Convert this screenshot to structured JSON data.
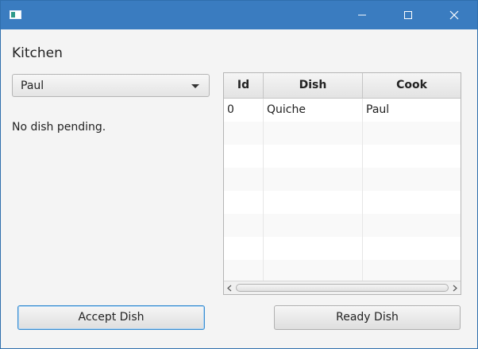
{
  "window": {
    "title": "",
    "colors": {
      "titlebar": "#3a7cc0",
      "background": "#f4f4f4",
      "focus": "#3b8ed0"
    }
  },
  "kitchen": {
    "heading": "Kitchen",
    "cook_select": {
      "selected": "Paul"
    },
    "status": "No dish pending."
  },
  "table": {
    "columns": [
      "Id",
      "Dish",
      "Cook"
    ],
    "rows": [
      [
        "0",
        "Quiche",
        "Paul"
      ],
      [
        "",
        "",
        ""
      ],
      [
        "",
        "",
        ""
      ],
      [
        "",
        "",
        ""
      ],
      [
        "",
        "",
        ""
      ],
      [
        "",
        "",
        ""
      ],
      [
        "",
        "",
        ""
      ],
      [
        "",
        "",
        ""
      ]
    ]
  },
  "actions": {
    "accept_label": "Accept Dish",
    "ready_label": "Ready Dish"
  },
  "icons": {
    "app": "app-icon",
    "minimize": "minimize-icon",
    "maximize": "maximize-icon",
    "close": "close-icon",
    "dropdown": "chevron-down-icon",
    "scroll_left": "arrow-left-icon",
    "scroll_right": "arrow-right-icon"
  }
}
